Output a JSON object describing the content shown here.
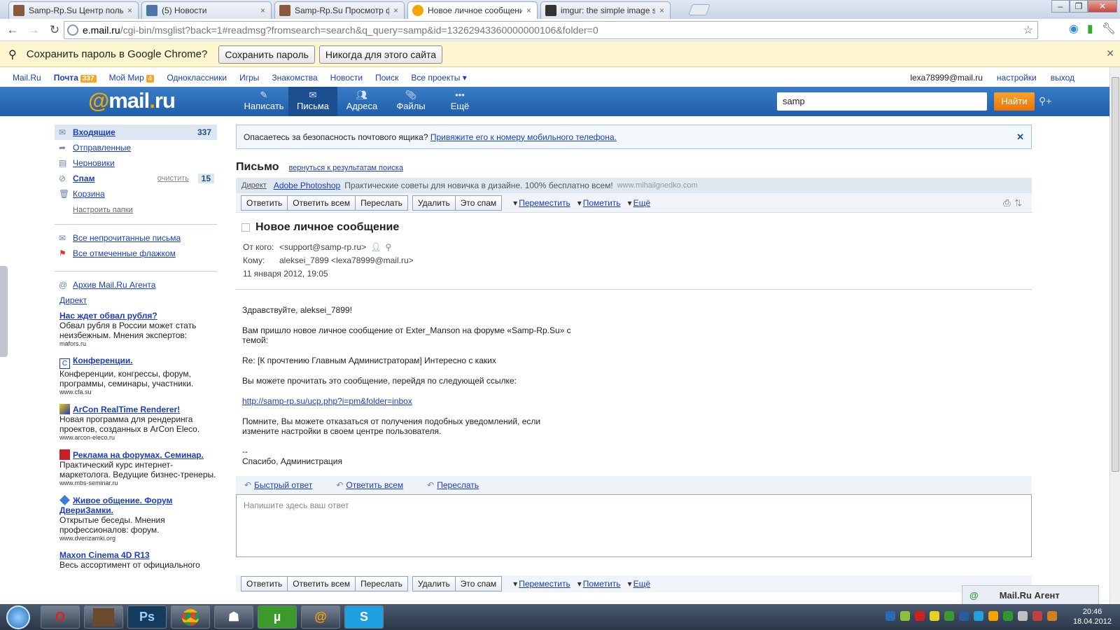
{
  "browser": {
    "tabs": [
      {
        "title": "Samp-Rp.Su Центр пользо",
        "color": "#8a5a3c"
      },
      {
        "title": "(5) Новости",
        "color": "#4a76a8"
      },
      {
        "title": "Samp-Rp.Su Просмотр фо",
        "color": "#8a5a3c"
      },
      {
        "title": "Новое личное сообщение",
        "color": "#f6a400"
      },
      {
        "title": "imgur: the simple image sh",
        "color": "#333333"
      }
    ],
    "close_glyph": "×",
    "window_buttons": [
      "–",
      "❐",
      "✕"
    ],
    "url_host": "e.mail.ru",
    "url_path": "/cgi-bin/msglist?back=1#readmsg?fromsearch=search&q_query=samp&id=13262943360000000106&folder=0"
  },
  "infobar": {
    "text": "Сохранить пароль в Google Chrome?",
    "save_label": "Сохранить пароль",
    "never_label": "Никогда для этого сайта"
  },
  "portal": {
    "items": [
      "Mail.Ru",
      "Почта",
      "Мой Мир",
      "Одноклассники",
      "Игры",
      "Знакомства",
      "Новости",
      "Поиск",
      "Все проекты"
    ],
    "mail_count": "337",
    "mir_count": "4",
    "user_email": "lexa78999@mail.ru",
    "settings": "настройки",
    "logout": "выход"
  },
  "header": {
    "logo_at": "@",
    "logo_name": "mail",
    "logo_dot": ".",
    "logo_tld": "ru",
    "nav": [
      "Написать",
      "Письма",
      "Адреса",
      "Файлы",
      "Ещё"
    ],
    "search_value": "samp",
    "search_button": "Найти"
  },
  "sidebar": {
    "folders": [
      {
        "label": "Входящие",
        "count": "337"
      },
      {
        "label": "Отправленные"
      },
      {
        "label": "Черновики"
      },
      {
        "label": "Спам",
        "clean": "очистить",
        "count": "15"
      },
      {
        "label": "Корзина"
      }
    ],
    "setup_folders": "Настроить папки",
    "unread": "Все непрочитанные письма",
    "flagged": "Все отмеченные флажком",
    "agent_archive": "Архив Mail.Ru Агента",
    "direct": "Директ",
    "ads": [
      {
        "title": "Нас ждет обвал рубля?",
        "body": "Обвал рубля в России может стать неизбежным. Мнения экспертов:",
        "url": "mafors.ru"
      },
      {
        "title": "Конференции.",
        "body": "Конференции, конгрессы, форум, программы, семинары, участники.",
        "url": "www.cfa.su"
      },
      {
        "title": "ArCon RealTime Renderer!",
        "body": "Новая программа для рендеринга проектов, созданных в ArCon Eleco.",
        "url": "www.arcon-eleco.ru"
      },
      {
        "title": "Реклама на форумах. Семинар.",
        "body": "Практический курс интернет-маркетолога. Ведущие бизнес-тренеры.",
        "url": "www.mbs-seminar.ru"
      },
      {
        "title": "Живое общение. Форум ДвериЗамки.",
        "body": "Открытые беседы. Мнения профессионалов: форум.",
        "url": "www.dverizamki.org"
      },
      {
        "title": "Maxon Cinema 4D R13",
        "body": "Весь ассортимент от официального",
        "url": ""
      }
    ]
  },
  "main": {
    "alert_text": "Опасаетесь за безопасность почтового ящика?",
    "alert_link": "Привяжите его к номеру мобильного телефона.",
    "letter_title": "Письмо",
    "back_to_results": "вернуться к результатам поиска",
    "direct_label": "Директ",
    "direct_ad_title": "Adobe Photoshop",
    "direct_ad_text": "Практические советы для новичка в дизайне. 100% бесплатно всем!",
    "direct_ad_url": "www.mihailgnedko.com",
    "actions": {
      "reply": "Ответить",
      "reply_all": "Ответить всем",
      "forward": "Переслать",
      "delete": "Удалить",
      "spam": "Это спам",
      "move": "Переместить",
      "mark": "Пометить",
      "more": "Ещё"
    },
    "subject": "Новое личное сообщение",
    "from_label": "От кого:",
    "from_value": "<support@samp-rp.ru>",
    "to_label": "Кому:",
    "to_value": "aleksei_7899 <lexa78999@mail.ru>",
    "date": "11 января 2012, 19:05",
    "body": {
      "greeting": "Здравствуйте, aleksei_7899!",
      "p1": "Вам пришло новое личное сообщение от Exter_Manson на форуме «Samp-Rp.Su» с темой:",
      "p2": "Re: [К прочтению Главным Администраторам] Интересно с каких",
      "p3": "Вы можете прочитать это сообщение, перейдя по следующей ссылке:",
      "link": "http://samp-rp.su/ucp.php?i=pm&folder=inbox",
      "p4": "Помните, Вы можете отказаться от получения подобных уведомлений, если измените настройки в своем центре пользователя.",
      "dash": "--",
      "sign": "Спасибо, Администрация"
    },
    "quick_reply": "Быстрый ответ",
    "reply_all_link": "Ответить всем",
    "forward_link": "Переслать",
    "reply_placeholder": "Напишите здесь ваш ответ"
  },
  "agent": {
    "title": "Mail.Ru Агент"
  },
  "taskbar": {
    "time": "20:46",
    "date": "18.04.2012",
    "apps": [
      "O",
      "",
      "Ps",
      "",
      "",
      "µ",
      "@",
      "S"
    ]
  },
  "colors": {
    "header_blue": "#2a6bb5",
    "link": "#1a3dc1",
    "accent_orange": "#f6a400"
  }
}
